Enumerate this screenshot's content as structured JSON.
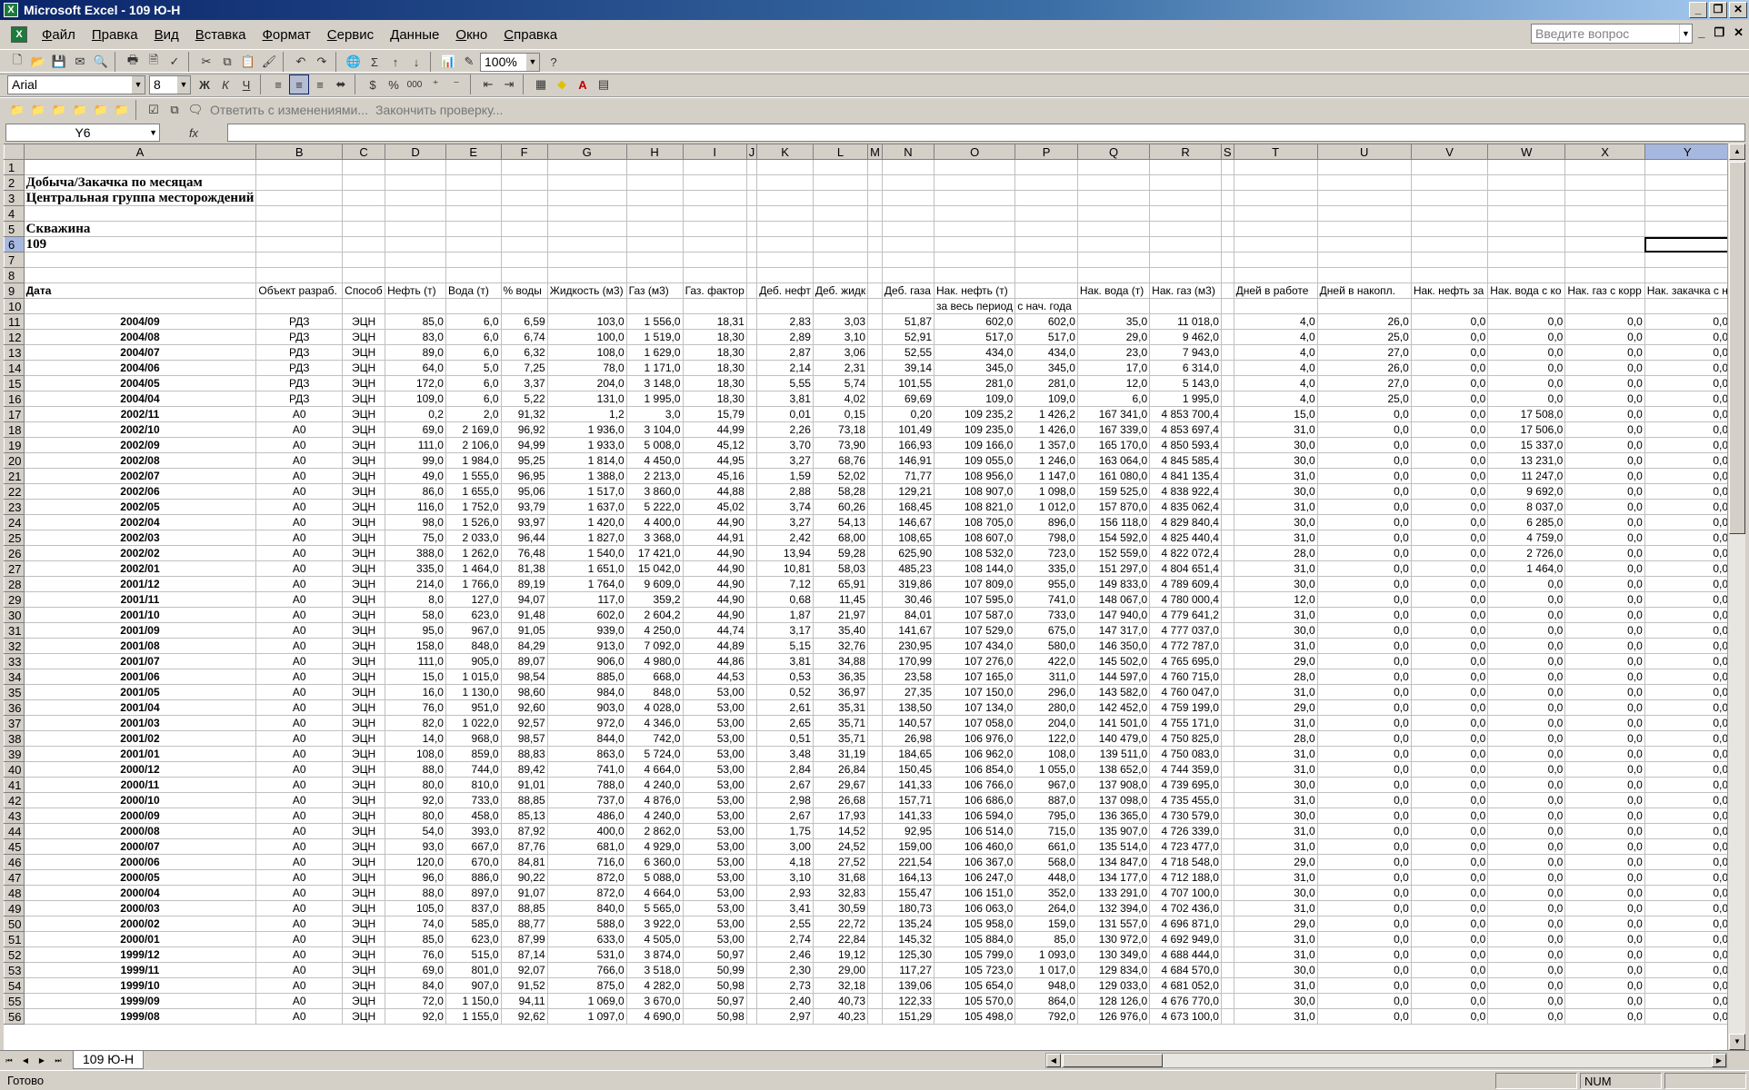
{
  "window": {
    "title": "Microsoft Excel - 109 Ю-Н",
    "icon_label": "X"
  },
  "menu": {
    "items": [
      "Файл",
      "Правка",
      "Вид",
      "Вставка",
      "Формат",
      "Сервис",
      "Данные",
      "Окно",
      "Справка"
    ],
    "help_placeholder": "Введите вопрос"
  },
  "toolbar": {
    "zoom": "100%",
    "font_name": "Arial",
    "font_size": "8",
    "review_reply": "Ответить с изменениями...",
    "review_end": "Закончить проверку...",
    "sigma": "Σ",
    "bold": "Ж",
    "italic": "К",
    "underline": "Ч",
    "percent": "%",
    "thousands": "000"
  },
  "formula_bar": {
    "name_box": "Y6",
    "fx": "fx"
  },
  "sheet": {
    "columns": [
      "A",
      "B",
      "C",
      "D",
      "E",
      "F",
      "G",
      "H",
      "I",
      "J",
      "K",
      "L",
      "M",
      "N",
      "O",
      "P",
      "Q",
      "R",
      "S",
      "T",
      "U",
      "V",
      "W",
      "X",
      "Y"
    ],
    "title1": "Добыча/Закачка по месяцам",
    "title2": "Центральная группа месторождений",
    "well_label": "Скважина",
    "well": "109",
    "headers": [
      "Дата",
      "Объект разраб.",
      "Способ",
      "Нефть (т)",
      "Вода (т)",
      "% воды",
      "Жидкость (м3)",
      "Газ (м3)",
      "Газ. фактор",
      "",
      "Деб. нефт",
      "Деб. жидк",
      "",
      "Деб. газа",
      "Нак. нефть (т)",
      "",
      "Нак. вода (т)",
      "Нак. газ (м3)",
      "",
      "Дней в работе",
      "Дней в накопл.",
      "Нак. нефть за",
      "Нак. вода с ко",
      "Нак. газ с корр",
      "Нак. закачка с н"
    ],
    "subheaders": {
      "O": "за весь период",
      "P": "с нач. года"
    },
    "rows": [
      [
        "2004/09",
        "РДЗ",
        "ЭЦН",
        "85,0",
        "6,0",
        "6,59",
        "103,0",
        "1 556,0",
        "18,31",
        "2,83",
        "3,03",
        "51,87",
        "602,0",
        "602,0",
        "35,0",
        "11 018,0",
        "4,0",
        "26,0",
        "0,0",
        "0,0",
        "0,0",
        "0,0"
      ],
      [
        "2004/08",
        "РДЗ",
        "ЭЦН",
        "83,0",
        "6,0",
        "6,74",
        "100,0",
        "1 519,0",
        "18,30",
        "2,89",
        "3,10",
        "52,91",
        "517,0",
        "517,0",
        "29,0",
        "9 462,0",
        "4,0",
        "25,0",
        "0,0",
        "0,0",
        "0,0",
        "0,0"
      ],
      [
        "2004/07",
        "РДЗ",
        "ЭЦН",
        "89,0",
        "6,0",
        "6,32",
        "108,0",
        "1 629,0",
        "18,30",
        "2,87",
        "3,06",
        "52,55",
        "434,0",
        "434,0",
        "23,0",
        "7 943,0",
        "4,0",
        "27,0",
        "0,0",
        "0,0",
        "0,0",
        "0,0"
      ],
      [
        "2004/06",
        "РДЗ",
        "ЭЦН",
        "64,0",
        "5,0",
        "7,25",
        "78,0",
        "1 171,0",
        "18,30",
        "2,14",
        "2,31",
        "39,14",
        "345,0",
        "345,0",
        "17,0",
        "6 314,0",
        "4,0",
        "26,0",
        "0,0",
        "0,0",
        "0,0",
        "0,0"
      ],
      [
        "2004/05",
        "РДЗ",
        "ЭЦН",
        "172,0",
        "6,0",
        "3,37",
        "204,0",
        "3 148,0",
        "18,30",
        "5,55",
        "5,74",
        "101,55",
        "281,0",
        "281,0",
        "12,0",
        "5 143,0",
        "4,0",
        "27,0",
        "0,0",
        "0,0",
        "0,0",
        "0,0"
      ],
      [
        "2004/04",
        "РДЗ",
        "ЭЦН",
        "109,0",
        "6,0",
        "5,22",
        "131,0",
        "1 995,0",
        "18,30",
        "3,81",
        "4,02",
        "69,69",
        "109,0",
        "109,0",
        "6,0",
        "1 995,0",
        "4,0",
        "25,0",
        "0,0",
        "0,0",
        "0,0",
        "0,0"
      ],
      [
        "2002/11",
        "А0",
        "ЭЦН",
        "0,2",
        "2,0",
        "91,32",
        "1,2",
        "3,0",
        "15,79",
        "0,01",
        "0,15",
        "0,20",
        "109 235,2",
        "1 426,2",
        "167 341,0",
        "4 853 700,4",
        "15,0",
        "0,0",
        "0,0",
        "17 508,0",
        "0,0",
        "0,0"
      ],
      [
        "2002/10",
        "А0",
        "ЭЦН",
        "69,0",
        "2 169,0",
        "96,92",
        "1 936,0",
        "3 104,0",
        "44,99",
        "2,26",
        "73,18",
        "101,49",
        "109 235,0",
        "1 426,0",
        "167 339,0",
        "4 853 697,4",
        "31,0",
        "0,0",
        "0,0",
        "17 506,0",
        "0,0",
        "0,0"
      ],
      [
        "2002/09",
        "А0",
        "ЭЦН",
        "111,0",
        "2 106,0",
        "94,99",
        "1 933,0",
        "5 008,0",
        "45,12",
        "3,70",
        "73,90",
        "166,93",
        "109 166,0",
        "1 357,0",
        "165 170,0",
        "4 850 593,4",
        "30,0",
        "0,0",
        "0,0",
        "15 337,0",
        "0,0",
        "0,0"
      ],
      [
        "2002/08",
        "А0",
        "ЭЦН",
        "99,0",
        "1 984,0",
        "95,25",
        "1 814,0",
        "4 450,0",
        "44,95",
        "3,27",
        "68,76",
        "146,91",
        "109 055,0",
        "1 246,0",
        "163 064,0",
        "4 845 585,4",
        "30,0",
        "0,0",
        "0,0",
        "13 231,0",
        "0,0",
        "0,0"
      ],
      [
        "2002/07",
        "А0",
        "ЭЦН",
        "49,0",
        "1 555,0",
        "96,95",
        "1 388,0",
        "2 213,0",
        "45,16",
        "1,59",
        "52,02",
        "71,77",
        "108 956,0",
        "1 147,0",
        "161 080,0",
        "4 841 135,4",
        "31,0",
        "0,0",
        "0,0",
        "11 247,0",
        "0,0",
        "0,0"
      ],
      [
        "2002/06",
        "А0",
        "ЭЦН",
        "86,0",
        "1 655,0",
        "95,06",
        "1 517,0",
        "3 860,0",
        "44,88",
        "2,88",
        "58,28",
        "129,21",
        "108 907,0",
        "1 098,0",
        "159 525,0",
        "4 838 922,4",
        "30,0",
        "0,0",
        "0,0",
        "9 692,0",
        "0,0",
        "0,0"
      ],
      [
        "2002/05",
        "А0",
        "ЭЦН",
        "116,0",
        "1 752,0",
        "93,79",
        "1 637,0",
        "5 222,0",
        "45,02",
        "3,74",
        "60,26",
        "168,45",
        "108 821,0",
        "1 012,0",
        "157 870,0",
        "4 835 062,4",
        "31,0",
        "0,0",
        "0,0",
        "8 037,0",
        "0,0",
        "0,0"
      ],
      [
        "2002/04",
        "А0",
        "ЭЦН",
        "98,0",
        "1 526,0",
        "93,97",
        "1 420,0",
        "4 400,0",
        "44,90",
        "3,27",
        "54,13",
        "146,67",
        "108 705,0",
        "896,0",
        "156 118,0",
        "4 829 840,4",
        "30,0",
        "0,0",
        "0,0",
        "6 285,0",
        "0,0",
        "0,0"
      ],
      [
        "2002/03",
        "А0",
        "ЭЦН",
        "75,0",
        "2 033,0",
        "96,44",
        "1 827,0",
        "3 368,0",
        "44,91",
        "2,42",
        "68,00",
        "108,65",
        "108 607,0",
        "798,0",
        "154 592,0",
        "4 825 440,4",
        "31,0",
        "0,0",
        "0,0",
        "4 759,0",
        "0,0",
        "0,0"
      ],
      [
        "2002/02",
        "А0",
        "ЭЦН",
        "388,0",
        "1 262,0",
        "76,48",
        "1 540,0",
        "17 421,0",
        "44,90",
        "13,94",
        "59,28",
        "625,90",
        "108 532,0",
        "723,0",
        "152 559,0",
        "4 822 072,4",
        "28,0",
        "0,0",
        "0,0",
        "2 726,0",
        "0,0",
        "0,0"
      ],
      [
        "2002/01",
        "А0",
        "ЭЦН",
        "335,0",
        "1 464,0",
        "81,38",
        "1 651,0",
        "15 042,0",
        "44,90",
        "10,81",
        "58,03",
        "485,23",
        "108 144,0",
        "335,0",
        "151 297,0",
        "4 804 651,4",
        "31,0",
        "0,0",
        "0,0",
        "1 464,0",
        "0,0",
        "0,0"
      ],
      [
        "2001/12",
        "А0",
        "ЭЦН",
        "214,0",
        "1 766,0",
        "89,19",
        "1 764,0",
        "9 609,0",
        "44,90",
        "7,12",
        "65,91",
        "319,86",
        "107 809,0",
        "955,0",
        "149 833,0",
        "4 789 609,4",
        "30,0",
        "0,0",
        "0,0",
        "0,0",
        "0,0",
        "0,0"
      ],
      [
        "2001/11",
        "А0",
        "ЭЦН",
        "8,0",
        "127,0",
        "94,07",
        "117,0",
        "359,2",
        "44,90",
        "0,68",
        "11,45",
        "30,46",
        "107 595,0",
        "741,0",
        "148 067,0",
        "4 780 000,4",
        "12,0",
        "0,0",
        "0,0",
        "0,0",
        "0,0",
        "0,0"
      ],
      [
        "2001/10",
        "А0",
        "ЭЦН",
        "58,0",
        "623,0",
        "91,48",
        "602,0",
        "2 604,2",
        "44,90",
        "1,87",
        "21,97",
        "84,01",
        "107 587,0",
        "733,0",
        "147 940,0",
        "4 779 641,2",
        "31,0",
        "0,0",
        "0,0",
        "0,0",
        "0,0",
        "0,0"
      ],
      [
        "2001/09",
        "А0",
        "ЭЦН",
        "95,0",
        "967,0",
        "91,05",
        "939,0",
        "4 250,0",
        "44,74",
        "3,17",
        "35,40",
        "141,67",
        "107 529,0",
        "675,0",
        "147 317,0",
        "4 777 037,0",
        "30,0",
        "0,0",
        "0,0",
        "0,0",
        "0,0",
        "0,0"
      ],
      [
        "2001/08",
        "А0",
        "ЭЦН",
        "158,0",
        "848,0",
        "84,29",
        "913,0",
        "7 092,0",
        "44,89",
        "5,15",
        "32,76",
        "230,95",
        "107 434,0",
        "580,0",
        "146 350,0",
        "4 772 787,0",
        "31,0",
        "0,0",
        "0,0",
        "0,0",
        "0,0",
        "0,0"
      ],
      [
        "2001/07",
        "А0",
        "ЭЦН",
        "111,0",
        "905,0",
        "89,07",
        "906,0",
        "4 980,0",
        "44,86",
        "3,81",
        "34,88",
        "170,99",
        "107 276,0",
        "422,0",
        "145 502,0",
        "4 765 695,0",
        "29,0",
        "0,0",
        "0,0",
        "0,0",
        "0,0",
        "0,0"
      ],
      [
        "2001/06",
        "А0",
        "ЭЦН",
        "15,0",
        "1 015,0",
        "98,54",
        "885,0",
        "668,0",
        "44,53",
        "0,53",
        "36,35",
        "23,58",
        "107 165,0",
        "311,0",
        "144 597,0",
        "4 760 715,0",
        "28,0",
        "0,0",
        "0,0",
        "0,0",
        "0,0",
        "0,0"
      ],
      [
        "2001/05",
        "А0",
        "ЭЦН",
        "16,0",
        "1 130,0",
        "98,60",
        "984,0",
        "848,0",
        "53,00",
        "0,52",
        "36,97",
        "27,35",
        "107 150,0",
        "296,0",
        "143 582,0",
        "4 760 047,0",
        "31,0",
        "0,0",
        "0,0",
        "0,0",
        "0,0",
        "0,0"
      ],
      [
        "2001/04",
        "А0",
        "ЭЦН",
        "76,0",
        "951,0",
        "92,60",
        "903,0",
        "4 028,0",
        "53,00",
        "2,61",
        "35,31",
        "138,50",
        "107 134,0",
        "280,0",
        "142 452,0",
        "4 759 199,0",
        "29,0",
        "0,0",
        "0,0",
        "0,0",
        "0,0",
        "0,0"
      ],
      [
        "2001/03",
        "А0",
        "ЭЦН",
        "82,0",
        "1 022,0",
        "92,57",
        "972,0",
        "4 346,0",
        "53,00",
        "2,65",
        "35,71",
        "140,57",
        "107 058,0",
        "204,0",
        "141 501,0",
        "4 755 171,0",
        "31,0",
        "0,0",
        "0,0",
        "0,0",
        "0,0",
        "0,0"
      ],
      [
        "2001/02",
        "А0",
        "ЭЦН",
        "14,0",
        "968,0",
        "98,57",
        "844,0",
        "742,0",
        "53,00",
        "0,51",
        "35,71",
        "26,98",
        "106 976,0",
        "122,0",
        "140 479,0",
        "4 750 825,0",
        "28,0",
        "0,0",
        "0,0",
        "0,0",
        "0,0",
        "0,0"
      ],
      [
        "2001/01",
        "А0",
        "ЭЦН",
        "108,0",
        "859,0",
        "88,83",
        "863,0",
        "5 724,0",
        "53,00",
        "3,48",
        "31,19",
        "184,65",
        "106 962,0",
        "108,0",
        "139 511,0",
        "4 750 083,0",
        "31,0",
        "0,0",
        "0,0",
        "0,0",
        "0,0",
        "0,0"
      ],
      [
        "2000/12",
        "А0",
        "ЭЦН",
        "88,0",
        "744,0",
        "89,42",
        "741,0",
        "4 664,0",
        "53,00",
        "2,84",
        "26,84",
        "150,45",
        "106 854,0",
        "1 055,0",
        "138 652,0",
        "4 744 359,0",
        "31,0",
        "0,0",
        "0,0",
        "0,0",
        "0,0",
        "0,0"
      ],
      [
        "2000/11",
        "А0",
        "ЭЦН",
        "80,0",
        "810,0",
        "91,01",
        "788,0",
        "4 240,0",
        "53,00",
        "2,67",
        "29,67",
        "141,33",
        "106 766,0",
        "967,0",
        "137 908,0",
        "4 739 695,0",
        "30,0",
        "0,0",
        "0,0",
        "0,0",
        "0,0",
        "0,0"
      ],
      [
        "2000/10",
        "А0",
        "ЭЦН",
        "92,0",
        "733,0",
        "88,85",
        "737,0",
        "4 876,0",
        "53,00",
        "2,98",
        "26,68",
        "157,71",
        "106 686,0",
        "887,0",
        "137 098,0",
        "4 735 455,0",
        "31,0",
        "0,0",
        "0,0",
        "0,0",
        "0,0",
        "0,0"
      ],
      [
        "2000/09",
        "А0",
        "ЭЦН",
        "80,0",
        "458,0",
        "85,13",
        "486,0",
        "4 240,0",
        "53,00",
        "2,67",
        "17,93",
        "141,33",
        "106 594,0",
        "795,0",
        "136 365,0",
        "4 730 579,0",
        "30,0",
        "0,0",
        "0,0",
        "0,0",
        "0,0",
        "0,0"
      ],
      [
        "2000/08",
        "А0",
        "ЭЦН",
        "54,0",
        "393,0",
        "87,92",
        "400,0",
        "2 862,0",
        "53,00",
        "1,75",
        "14,52",
        "92,95",
        "106 514,0",
        "715,0",
        "135 907,0",
        "4 726 339,0",
        "31,0",
        "0,0",
        "0,0",
        "0,0",
        "0,0",
        "0,0"
      ],
      [
        "2000/07",
        "А0",
        "ЭЦН",
        "93,0",
        "667,0",
        "87,76",
        "681,0",
        "4 929,0",
        "53,00",
        "3,00",
        "24,52",
        "159,00",
        "106 460,0",
        "661,0",
        "135 514,0",
        "4 723 477,0",
        "31,0",
        "0,0",
        "0,0",
        "0,0",
        "0,0",
        "0,0"
      ],
      [
        "2000/06",
        "А0",
        "ЭЦН",
        "120,0",
        "670,0",
        "84,81",
        "716,0",
        "6 360,0",
        "53,00",
        "4,18",
        "27,52",
        "221,54",
        "106 367,0",
        "568,0",
        "134 847,0",
        "4 718 548,0",
        "29,0",
        "0,0",
        "0,0",
        "0,0",
        "0,0",
        "0,0"
      ],
      [
        "2000/05",
        "А0",
        "ЭЦН",
        "96,0",
        "886,0",
        "90,22",
        "872,0",
        "5 088,0",
        "53,00",
        "3,10",
        "31,68",
        "164,13",
        "106 247,0",
        "448,0",
        "134 177,0",
        "4 712 188,0",
        "31,0",
        "0,0",
        "0,0",
        "0,0",
        "0,0",
        "0,0"
      ],
      [
        "2000/04",
        "А0",
        "ЭЦН",
        "88,0",
        "897,0",
        "91,07",
        "872,0",
        "4 664,0",
        "53,00",
        "2,93",
        "32,83",
        "155,47",
        "106 151,0",
        "352,0",
        "133 291,0",
        "4 707 100,0",
        "30,0",
        "0,0",
        "0,0",
        "0,0",
        "0,0",
        "0,0"
      ],
      [
        "2000/03",
        "А0",
        "ЭЦН",
        "105,0",
        "837,0",
        "88,85",
        "840,0",
        "5 565,0",
        "53,00",
        "3,41",
        "30,59",
        "180,73",
        "106 063,0",
        "264,0",
        "132 394,0",
        "4 702 436,0",
        "31,0",
        "0,0",
        "0,0",
        "0,0",
        "0,0",
        "0,0"
      ],
      [
        "2000/02",
        "А0",
        "ЭЦН",
        "74,0",
        "585,0",
        "88,77",
        "588,0",
        "3 922,0",
        "53,00",
        "2,55",
        "22,72",
        "135,24",
        "105 958,0",
        "159,0",
        "131 557,0",
        "4 696 871,0",
        "29,0",
        "0,0",
        "0,0",
        "0,0",
        "0,0",
        "0,0"
      ],
      [
        "2000/01",
        "А0",
        "ЭЦН",
        "85,0",
        "623,0",
        "87,99",
        "633,0",
        "4 505,0",
        "53,00",
        "2,74",
        "22,84",
        "145,32",
        "105 884,0",
        "85,0",
        "130 972,0",
        "4 692 949,0",
        "31,0",
        "0,0",
        "0,0",
        "0,0",
        "0,0",
        "0,0"
      ],
      [
        "1999/12",
        "А0",
        "ЭЦН",
        "76,0",
        "515,0",
        "87,14",
        "531,0",
        "3 874,0",
        "50,97",
        "2,46",
        "19,12",
        "125,30",
        "105 799,0",
        "1 093,0",
        "130 349,0",
        "4 688 444,0",
        "31,0",
        "0,0",
        "0,0",
        "0,0",
        "0,0",
        "0,0"
      ],
      [
        "1999/11",
        "А0",
        "ЭЦН",
        "69,0",
        "801,0",
        "92,07",
        "766,0",
        "3 518,0",
        "50,99",
        "2,30",
        "29,00",
        "117,27",
        "105 723,0",
        "1 017,0",
        "129 834,0",
        "4 684 570,0",
        "30,0",
        "0,0",
        "0,0",
        "0,0",
        "0,0",
        "0,0"
      ],
      [
        "1999/10",
        "А0",
        "ЭЦН",
        "84,0",
        "907,0",
        "91,52",
        "875,0",
        "4 282,0",
        "50,98",
        "2,73",
        "32,18",
        "139,06",
        "105 654,0",
        "948,0",
        "129 033,0",
        "4 681 052,0",
        "31,0",
        "0,0",
        "0,0",
        "0,0",
        "0,0",
        "0,0"
      ],
      [
        "1999/09",
        "А0",
        "ЭЦН",
        "72,0",
        "1 150,0",
        "94,11",
        "1 069,0",
        "3 670,0",
        "50,97",
        "2,40",
        "40,73",
        "122,33",
        "105 570,0",
        "864,0",
        "128 126,0",
        "4 676 770,0",
        "30,0",
        "0,0",
        "0,0",
        "0,0",
        "0,0",
        "0,0"
      ],
      [
        "1999/08",
        "А0",
        "ЭЦН",
        "92,0",
        "1 155,0",
        "92,62",
        "1 097,0",
        "4 690,0",
        "50,98",
        "2,97",
        "40,23",
        "151,29",
        "105 498,0",
        "792,0",
        "126 976,0",
        "4 673 100,0",
        "31,0",
        "0,0",
        "0,0",
        "0,0",
        "0,0",
        "0,0"
      ]
    ]
  },
  "sheet_tab": "109 Ю-Н",
  "status": {
    "ready": "Готово",
    "num": "NUM"
  }
}
